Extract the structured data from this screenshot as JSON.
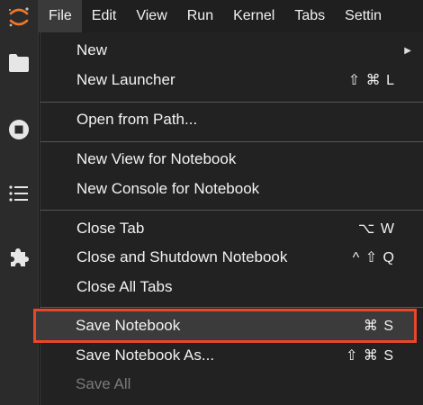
{
  "menubar": {
    "items": [
      "File",
      "Edit",
      "View",
      "Run",
      "Kernel",
      "Tabs",
      "Settin"
    ]
  },
  "sidebar": {
    "icons": [
      "folder-icon",
      "stop-circle-icon",
      "list-icon",
      "puzzle-icon"
    ]
  },
  "menu": {
    "items": [
      {
        "label": "New",
        "shortcut": "",
        "submenu": true,
        "disabled": false
      },
      {
        "label": "New Launcher",
        "shortcut": "⇧ ⌘ L",
        "submenu": false,
        "disabled": false
      },
      {
        "label": "Open from Path...",
        "shortcut": "",
        "submenu": false,
        "disabled": false
      },
      {
        "label": "New View for Notebook",
        "shortcut": "",
        "submenu": false,
        "disabled": false
      },
      {
        "label": "New Console for Notebook",
        "shortcut": "",
        "submenu": false,
        "disabled": false
      },
      {
        "label": "Close Tab",
        "shortcut": "⌥ W",
        "submenu": false,
        "disabled": false
      },
      {
        "label": "Close and Shutdown Notebook",
        "shortcut": "^ ⇧ Q",
        "submenu": false,
        "disabled": false
      },
      {
        "label": "Close All Tabs",
        "shortcut": "",
        "submenu": false,
        "disabled": false
      },
      {
        "label": "Save Notebook",
        "shortcut": "⌘ S",
        "submenu": false,
        "disabled": false
      },
      {
        "label": "Save Notebook As...",
        "shortcut": "⇧ ⌘ S",
        "submenu": false,
        "disabled": false
      },
      {
        "label": "Save All",
        "shortcut": "",
        "submenu": false,
        "disabled": true
      }
    ],
    "submenu_arrow": "▶"
  },
  "colors": {
    "highlight_border": "#e8472a",
    "logo_orange": "#f37726"
  }
}
